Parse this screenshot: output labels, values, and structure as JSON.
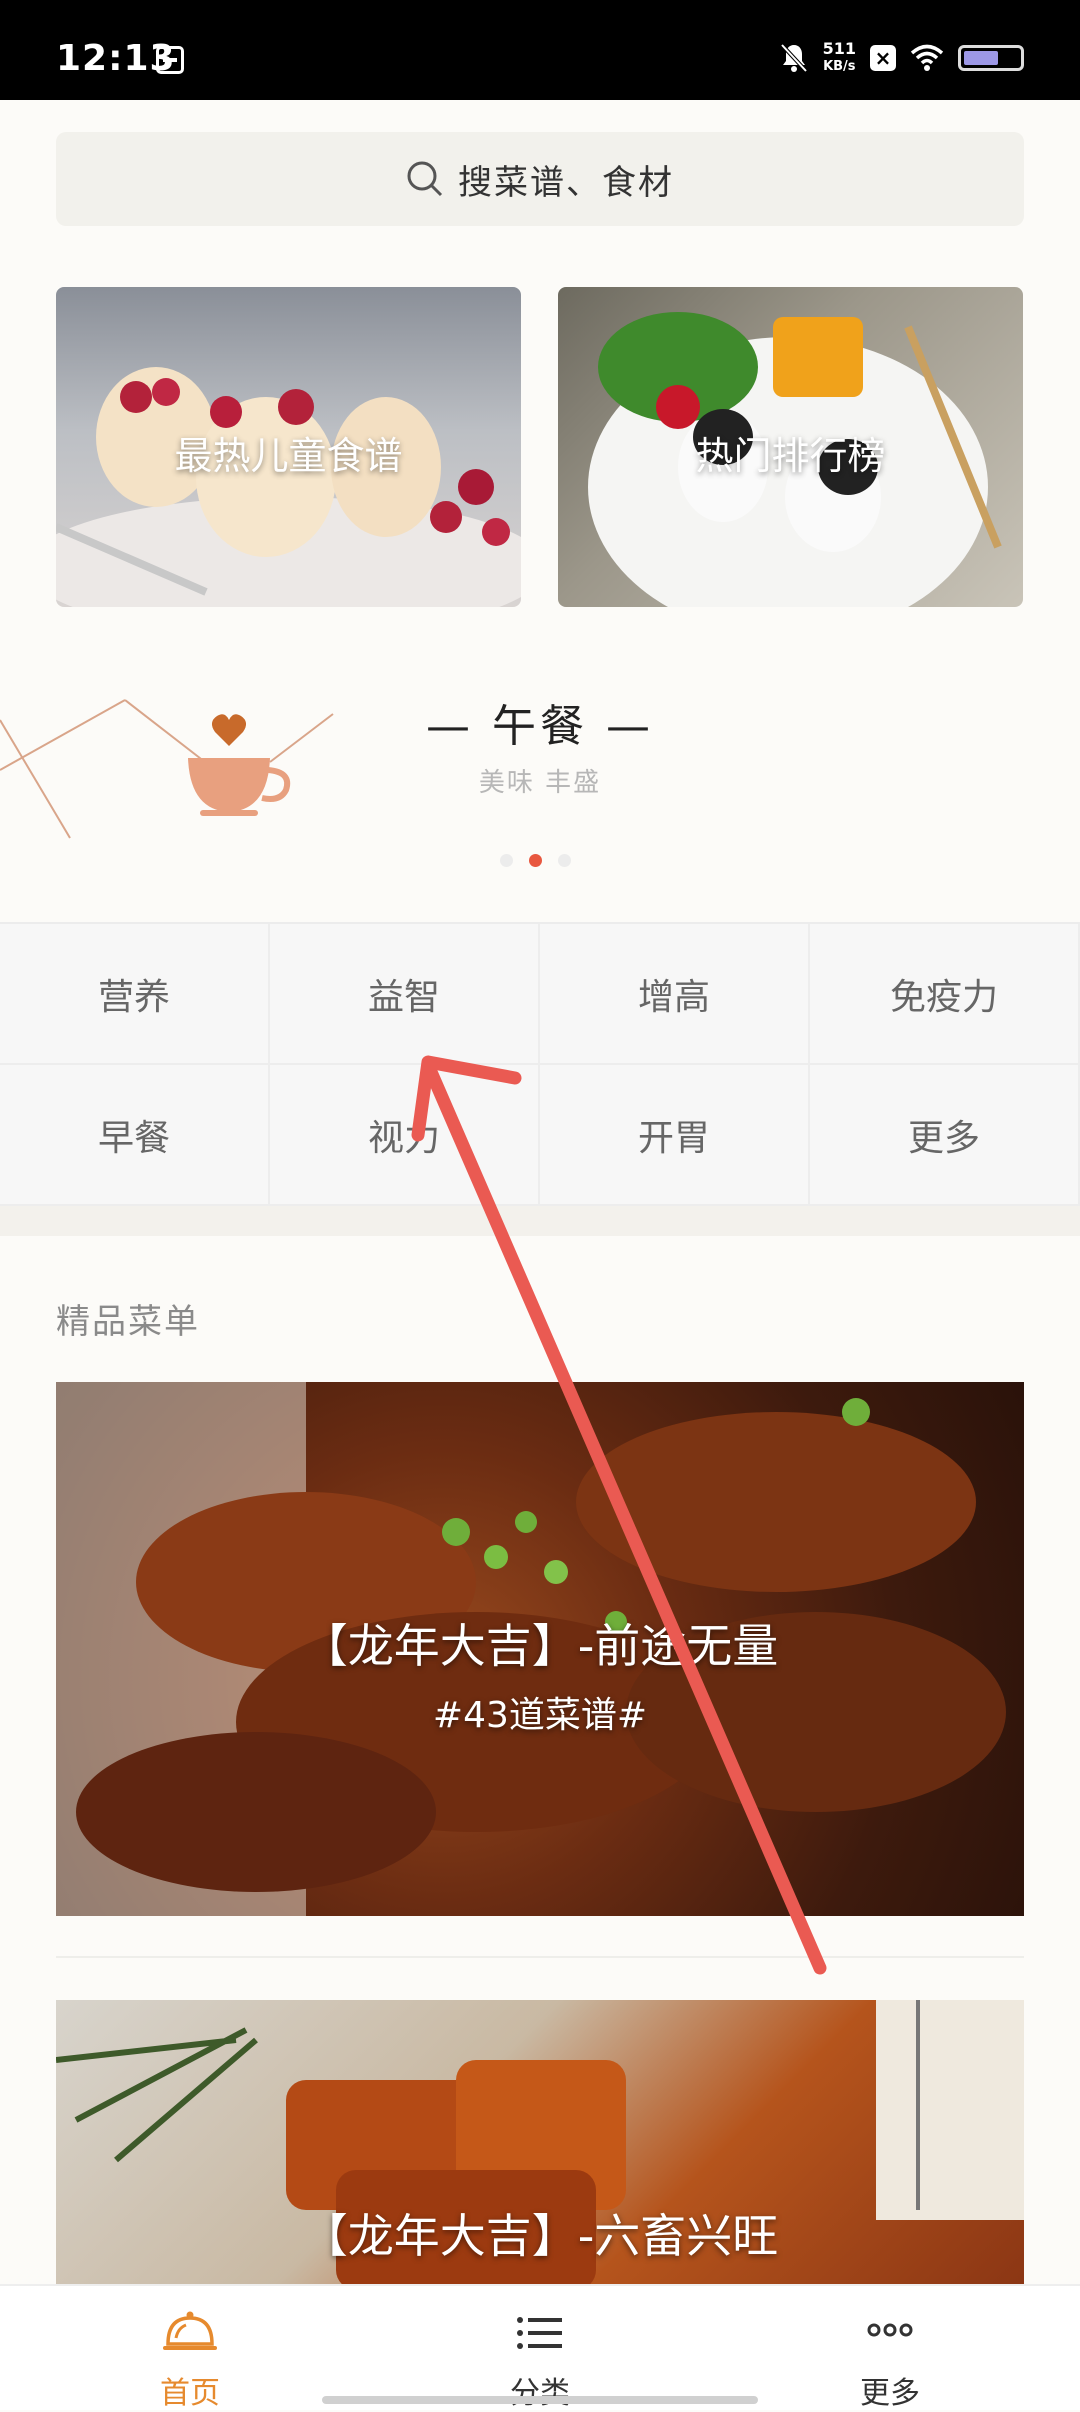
{
  "status": {
    "time": "12:13",
    "speed_value": "511",
    "speed_unit": "KB/s"
  },
  "search": {
    "placeholder": "搜菜谱、食材"
  },
  "banners": [
    {
      "label": "最热儿童食谱"
    },
    {
      "label": "热门排行榜"
    }
  ],
  "meal": {
    "title": "— 午餐 —",
    "subtitle": "美味 丰盛"
  },
  "categories": [
    "营养",
    "益智",
    "增高",
    "免疫力",
    "早餐",
    "视力",
    "开胃",
    "更多"
  ],
  "featured": {
    "title": "精品菜单",
    "cards": [
      {
        "title": "【龙年大吉】-前途无量",
        "subtitle": "#43道菜谱#"
      },
      {
        "title": "【龙年大吉】-六畜兴旺"
      }
    ]
  },
  "nav": [
    {
      "label": "首页"
    },
    {
      "label": "分类"
    },
    {
      "label": "更多"
    }
  ],
  "colors": {
    "accent": "#e68a2e",
    "annotation_arrow": "#ea5a52",
    "pager_active": "#e8573f"
  }
}
